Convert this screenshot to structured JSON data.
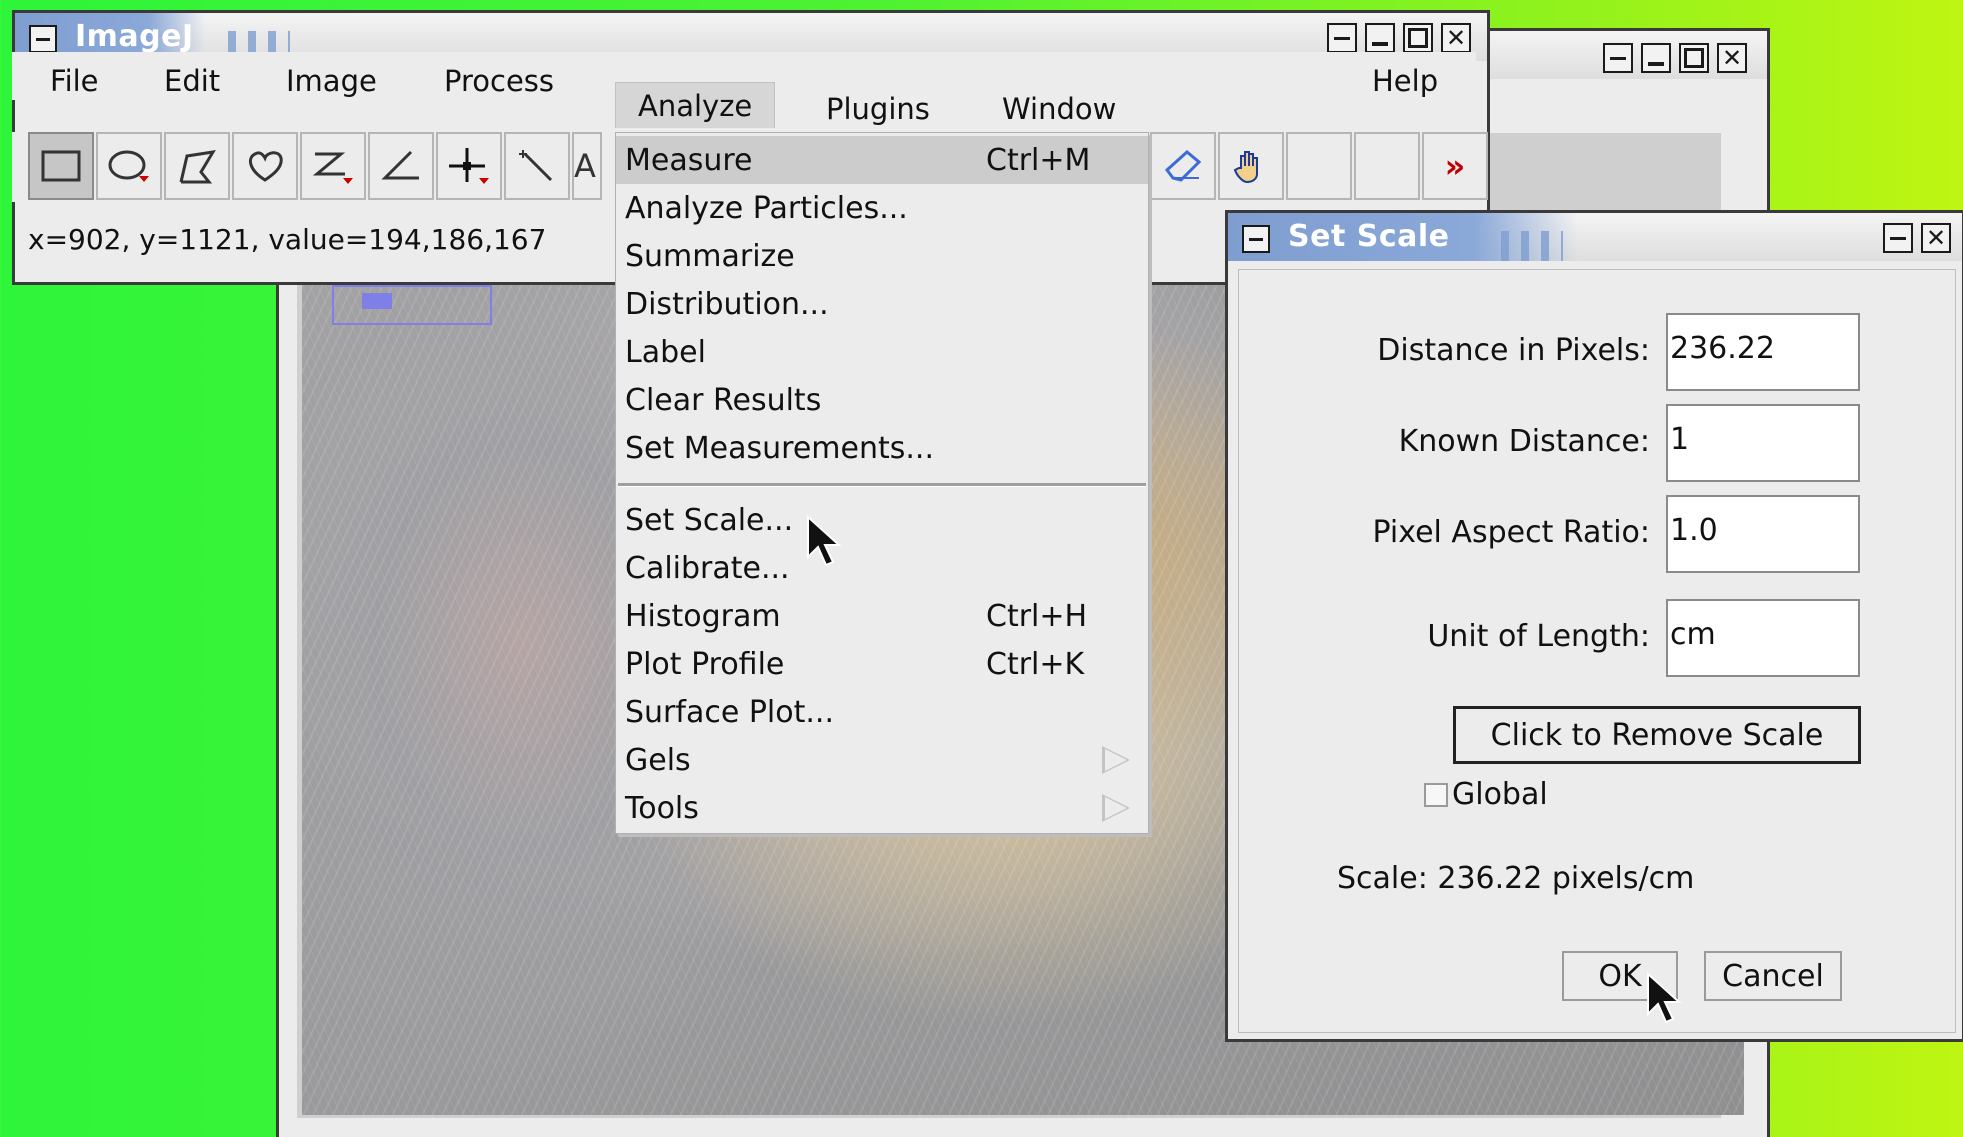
{
  "imagej_window": {
    "title": "ImageJ",
    "menus": [
      "File",
      "Edit",
      "Image",
      "Process",
      "Analyze",
      "Plugins",
      "Window",
      "Help"
    ],
    "active_menu": "Analyze",
    "status": "x=902, y=1121, value=194,186,167",
    "more_tools": "»"
  },
  "analyze_menu": {
    "items": [
      {
        "label": "Measure",
        "shortcut": "Ctrl+M"
      },
      {
        "label": "Analyze Particles...",
        "shortcut": ""
      },
      {
        "label": "Summarize",
        "shortcut": ""
      },
      {
        "label": "Distribution...",
        "shortcut": ""
      },
      {
        "label": "Label",
        "shortcut": ""
      },
      {
        "label": "Clear Results",
        "shortcut": ""
      },
      {
        "label": "Set Measurements...",
        "shortcut": ""
      },
      {
        "label": "Set Scale...",
        "shortcut": ""
      },
      {
        "label": "Calibrate...",
        "shortcut": ""
      },
      {
        "label": "Histogram",
        "shortcut": "Ctrl+H"
      },
      {
        "label": "Plot Profile",
        "shortcut": "Ctrl+K"
      },
      {
        "label": "Surface Plot...",
        "shortcut": ""
      },
      {
        "label": "Gels",
        "shortcut": ""
      },
      {
        "label": "Tools",
        "shortcut": ""
      }
    ]
  },
  "set_scale_dialog": {
    "title": "Set Scale",
    "distance_label": "Distance in Pixels:",
    "distance_value": "236.22",
    "known_label": "Known Distance:",
    "known_value": "1",
    "aspect_label": "Pixel Aspect Ratio:",
    "aspect_value": "1.0",
    "unit_label": "Unit of Length:",
    "unit_value": "cm",
    "remove_button": "Click to Remove Scale",
    "global_label": "Global",
    "global_checked": false,
    "scale_text": "Scale: 236.22 pixels/cm",
    "ok_button": "OK",
    "cancel_button": "Cancel"
  },
  "colors": {
    "title_bar_accent": "#7f9ed0",
    "menu_highlight": "#cccccc",
    "desktop_green": "#2ef43a",
    "desktop_yellow": "#bff512"
  }
}
